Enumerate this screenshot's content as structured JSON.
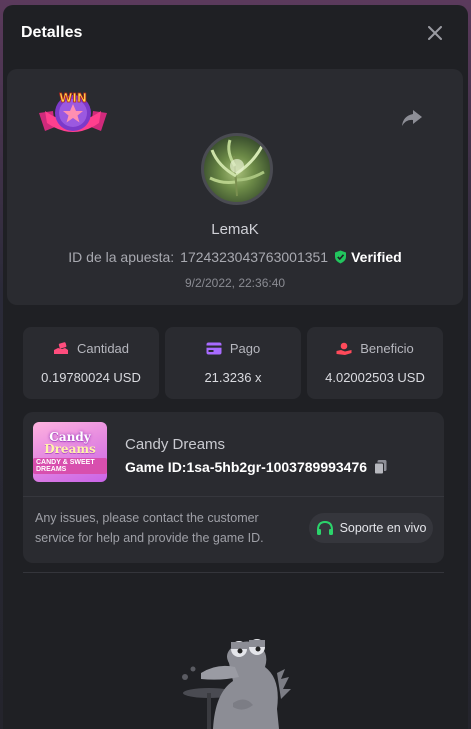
{
  "modal": {
    "title": "Detalles",
    "close_icon": "close-icon"
  },
  "bet": {
    "badge_text": "WIN",
    "username": "LemaK",
    "id_label": "ID de la apuesta:",
    "id_value": "1724323043763001351",
    "verified_label": "Verified",
    "datetime": "9/2/2022, 22:36:40"
  },
  "stats": [
    {
      "label": "Cantidad",
      "value": "0.19780024 USD",
      "icon": "bet-hand-icon"
    },
    {
      "label": "Pago",
      "value": "21.3236 x",
      "icon": "card-icon"
    },
    {
      "label": "Beneficio",
      "value": "4.02002503 USD",
      "icon": "profit-hand-icon"
    }
  ],
  "game": {
    "thumb_title_1": "Candy",
    "thumb_title_2": "Dreams",
    "thumb_sub": "CANDY & SWEET DREAMS",
    "name": "Candy Dreams",
    "id_text": "Game ID:1sa-5hb2gr-1003789993476",
    "help_text": "Any issues, please contact the customer service for help and provide the game ID.",
    "support_label": "Soporte en vivo"
  },
  "colors": {
    "accent_pink": "#ff4d7d",
    "accent_purple": "#a86bff",
    "accent_red": "#ff4a5a",
    "verified_green": "#22c55e",
    "support_green": "#2bd46b"
  }
}
